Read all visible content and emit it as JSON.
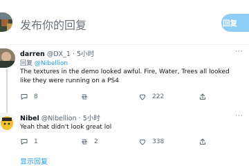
{
  "compose": {
    "placeholder": "发布你的回复",
    "reply_button": "回复"
  },
  "tweets": [
    {
      "name": "darren",
      "handle": "@DX_1",
      "time": "· 5小时",
      "reply_prefix": "回复",
      "reply_mention": "@Nibellion",
      "text": "The textures in the demo looked awful. Fire, Water, Trees all looked like they were running on a PS4",
      "comments": "8",
      "retweets": "",
      "likes": "222",
      "more": "···"
    },
    {
      "name": "Nibel",
      "handle": "@Nibellion",
      "time": "· 5小时",
      "text": "Yeah that didn't look great lol",
      "comments": "1",
      "retweets": "2",
      "likes": "338",
      "more": "···"
    }
  ],
  "show_replies": "显示回复",
  "colors": {
    "accent": "#1d9bf0",
    "reply_button_bg": "#8ecdf8",
    "muted": "#536471"
  },
  "icons": [
    "comment-icon",
    "retweet-icon",
    "like-icon",
    "share-icon"
  ]
}
